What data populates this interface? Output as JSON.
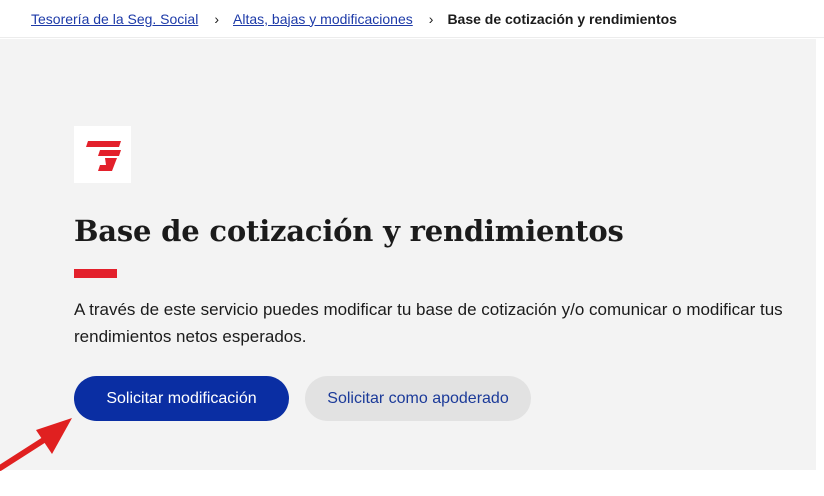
{
  "breadcrumb": {
    "items": [
      "Tesorería de la Seg. Social",
      "Altas, bajas y modificaciones"
    ],
    "current": "Base de cotización y rendimientos",
    "separator": "›"
  },
  "hero": {
    "title": "Base de cotización y rendimientos",
    "description": "A través de este servicio puedes modificar tu base de cotización y/o comunicar o modificar tus rendimientos netos esperados.",
    "logo_icon": "seguridad-social-logo-icon"
  },
  "actions": {
    "primary_label": "Solicitar modificación",
    "secondary_label": "Solicitar como apoderado"
  },
  "colors": {
    "accent": "#e3202b",
    "primary_button": "#0a2ea3",
    "link": "#1d3aa8",
    "annotation_arrow": "#e02020"
  }
}
